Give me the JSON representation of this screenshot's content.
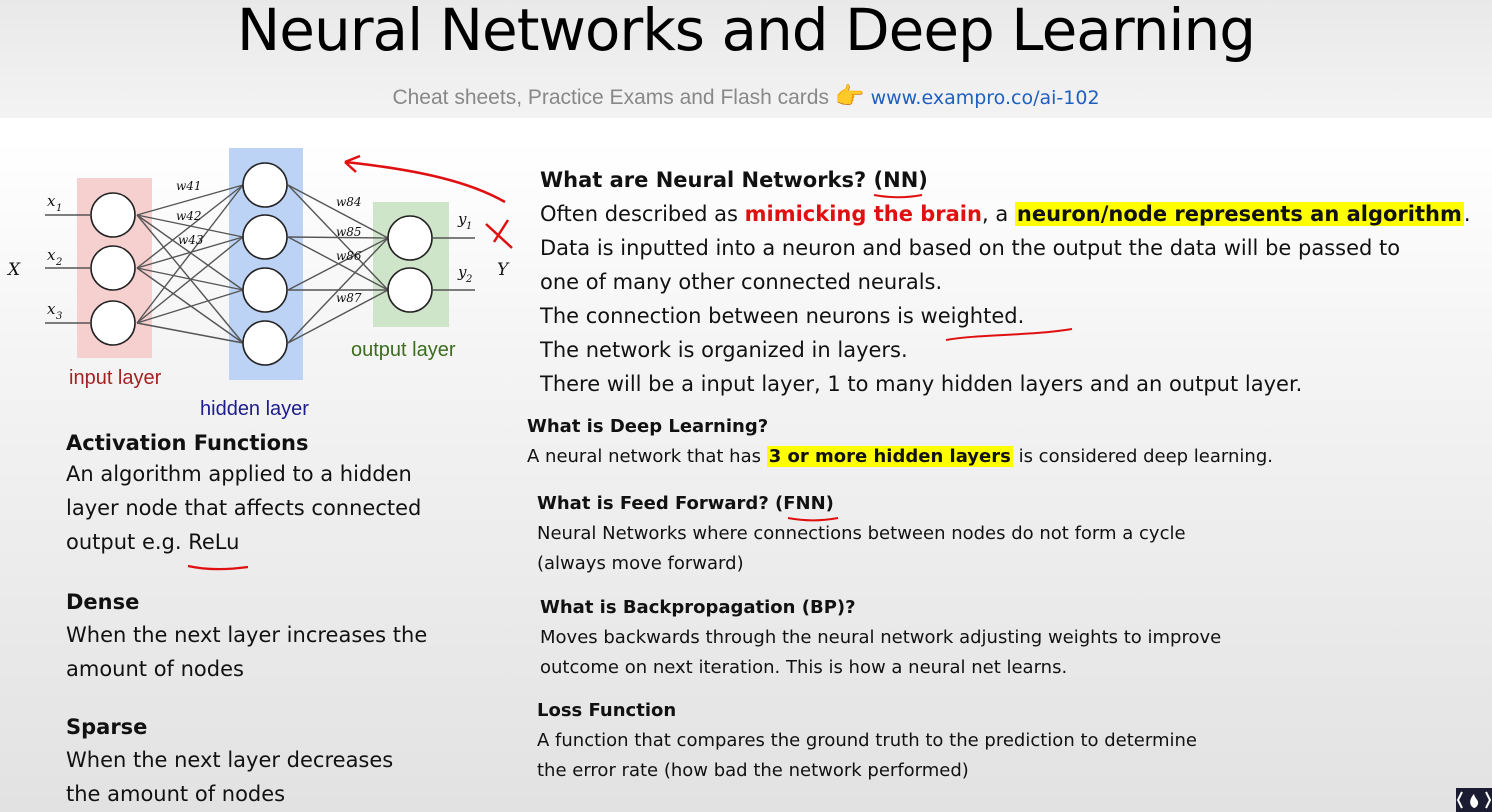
{
  "header": {
    "title": "Neural Networks and Deep Learning",
    "subtitle": "Cheat sheets, Practice Exams and Flash cards",
    "hand_icon": "👉",
    "link": "www.exampro.co/ai-102"
  },
  "diagram": {
    "input_label": "input layer",
    "hidden_label": "hidden layer",
    "output_label": "output layer",
    "x_label": "X",
    "y_label": "Y",
    "inputs": [
      "x",
      "x",
      "x"
    ],
    "input_subs": [
      "1",
      "2",
      "3"
    ],
    "outputs": [
      "y",
      "y"
    ],
    "output_subs": [
      "1",
      "2"
    ],
    "weights": [
      "w41",
      "w42",
      "w43",
      "w84",
      "w85",
      "w86",
      "w87"
    ],
    "colors": {
      "input": "#f6cfcf",
      "hidden": "#bcd3f5",
      "output": "#cfe5c9",
      "input_text": "#a32323",
      "hidden_text": "#1c1c8c",
      "output_text": "#3c6c1c"
    }
  },
  "left": {
    "activation": {
      "title": "Activation Functions",
      "line1": "An algorithm applied to a hidden",
      "line2": "layer node that affects connected",
      "line3": "output  e.g. ReLu"
    },
    "dense": {
      "title": "Dense",
      "line1": "When the next layer increases the",
      "line2": "amount of nodes"
    },
    "sparse": {
      "title": "Sparse",
      "line1": "When the next layer decreases",
      "line2": "the amount of nodes"
    }
  },
  "nn": {
    "title": "What are Neural Networks? (NN)",
    "l1a": "Often described as ",
    "l1b": "mimicking the brain",
    "l1c": ", a ",
    "l1d": "neuron/node represents an algorithm",
    "l1e": ".",
    "l2": "Data is inputted into a neuron and based on the output the data will be passed to",
    "l3": "one of many other connected neurals.",
    "l4": "The connection between neurons is weighted.",
    "l5": "The network is organized in layers.",
    "l6": "There will be a input layer, 1 to many hidden layers and an output layer."
  },
  "deep": {
    "title": "What is Deep Learning?",
    "a": "A neural network that has ",
    "b": "3 or more hidden layers",
    "c": " is considered deep learning."
  },
  "ff": {
    "title": "What is Feed Forward? (FNN)",
    "l1": "Neural Networks where connections between nodes do not form a cycle",
    "l2": "(always move forward)"
  },
  "bp": {
    "title": "What is Backpropagation (BP)?",
    "l1": "Moves backwards through the neural network adjusting weights to improve",
    "l2": "outcome on next iteration. This is how a neural net learns."
  },
  "loss": {
    "title": "Loss Function",
    "l1": "A function that compares the ground truth to the prediction to determine",
    "l2": "the error rate (how bad the network performed)"
  }
}
